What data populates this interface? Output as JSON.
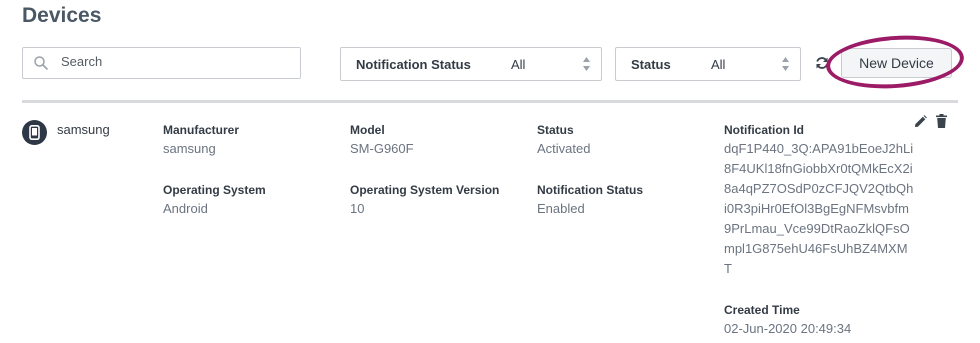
{
  "page": {
    "title": "Devices"
  },
  "toolbar": {
    "search_placeholder": "Search",
    "filters": [
      {
        "label": "Notification Status",
        "value": "All"
      },
      {
        "label": "Status",
        "value": "All"
      }
    ],
    "new_device_label": "New Device",
    "highlight_color": "#9b1b67"
  },
  "device": {
    "name": "samsung",
    "fields": {
      "manufacturer": {
        "label": "Manufacturer",
        "value": "samsung"
      },
      "model": {
        "label": "Model",
        "value": "SM-G960F"
      },
      "status": {
        "label": "Status",
        "value": "Activated"
      },
      "os": {
        "label": "Operating System",
        "value": "Android"
      },
      "os_version": {
        "label": "Operating System Version",
        "value": "10"
      },
      "notification_status": {
        "label": "Notification Status",
        "value": "Enabled"
      },
      "notification_id": {
        "label": "Notification Id",
        "value": "dqF1P440_3Q:APA91bEoeJ2hLi8F4UKl18fnGiobbXr0tQMkEcX2i8a4qPZ7OSdP0zCFJQV2QtbQhi0R3piHr0EfOl3BgEgNFMsvbfm9PrLmau_Vce99DtRaoZklQFsOmpl1G875ehU46FsUhBZ4MXMT"
      },
      "created_time": {
        "label": "Created Time",
        "value": "02-Jun-2020 20:49:34"
      }
    }
  },
  "icons": {
    "search": "search-icon",
    "refresh": "refresh-icon",
    "edit": "edit-icon",
    "delete": "trash-icon",
    "device": "mobile-phone-icon",
    "sort": "sort-arrows-icon"
  }
}
